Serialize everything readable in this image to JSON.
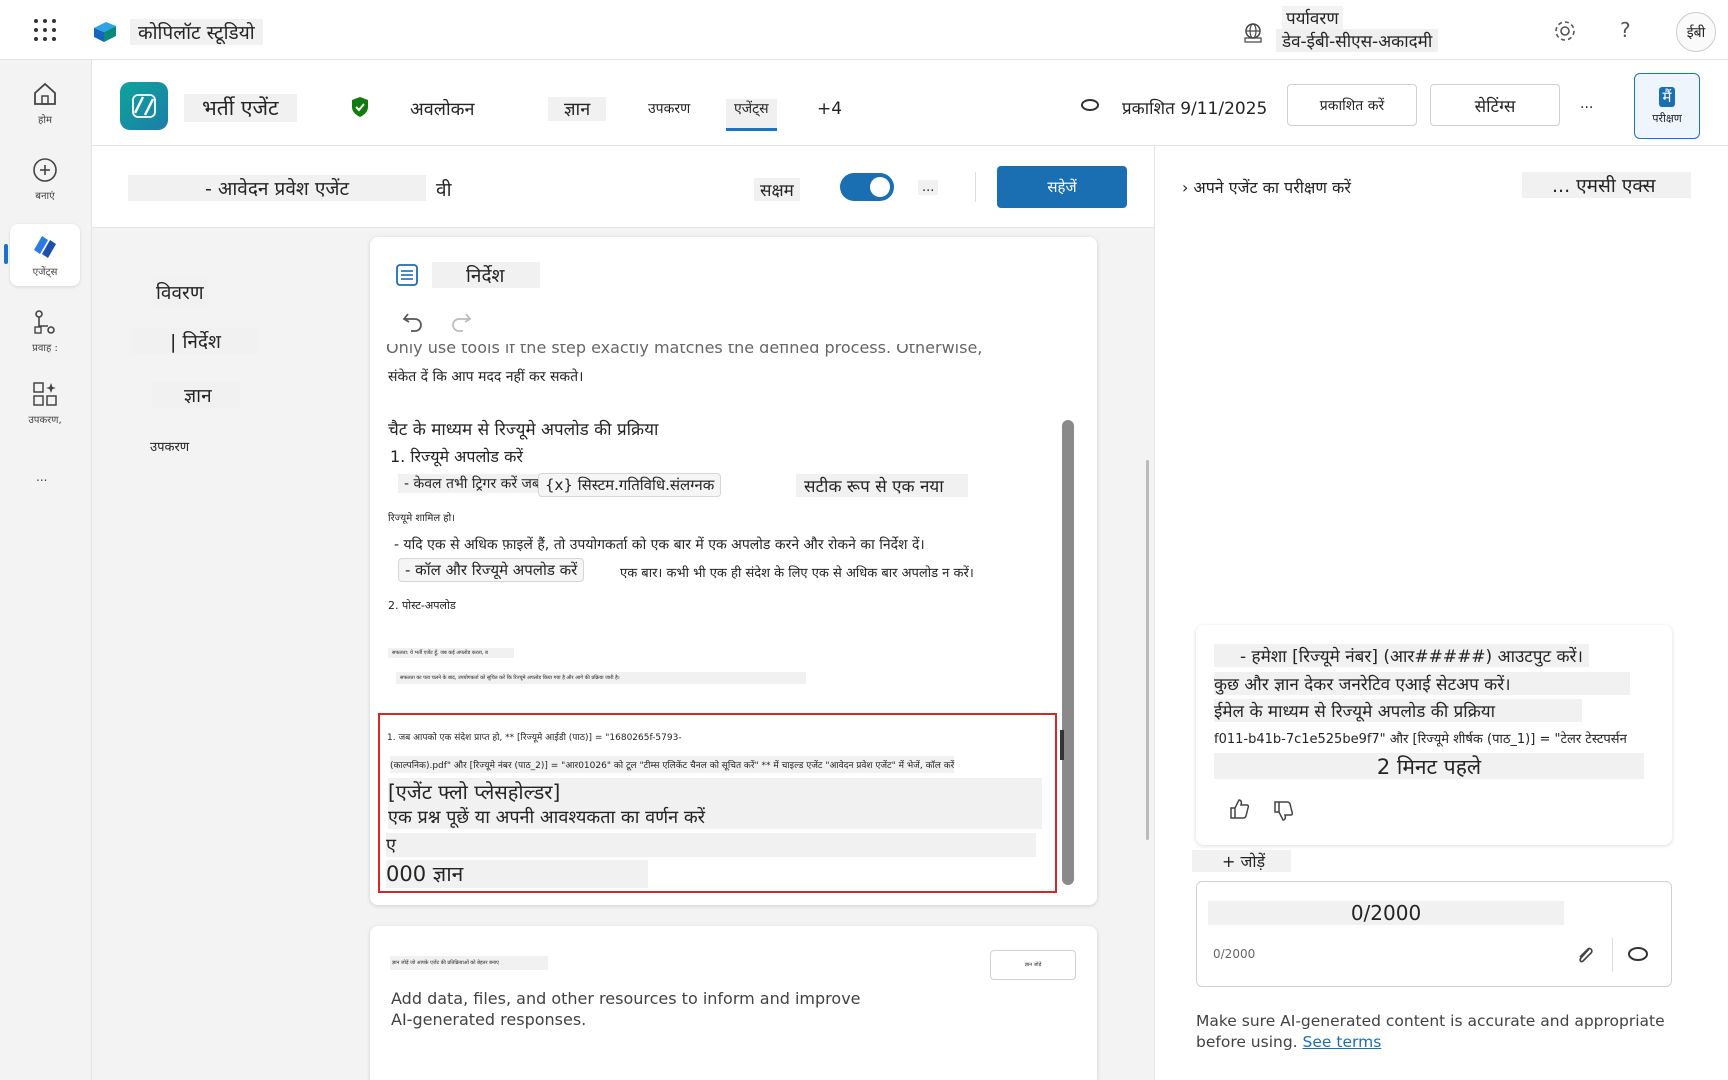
{
  "topbar": {
    "app_name": "कोपिलॉट स्टूडियो",
    "env_label": "पर्यावरण",
    "env_value": "डेव-ईबी-सीएस-अकादमी",
    "avatar_initials": "ईबी",
    "help": "?"
  },
  "rail": [
    {
      "label": "होम",
      "icon": "home-icon"
    },
    {
      "label": "बनाएं",
      "icon": "plus-circle-icon"
    },
    {
      "label": "एजेंट्स",
      "icon": "agents-icon"
    },
    {
      "label": "प्रवाह :",
      "icon": "flow-icon"
    },
    {
      "label": "उपकरण,",
      "icon": "tools-icon"
    },
    {
      "label": "...",
      "icon": "more-icon"
    }
  ],
  "header": {
    "agent_name": "भर्ती एजेंट",
    "tabs": [
      "अवलोकन",
      "ज्ञान",
      "उपकरण",
      "एजेंट्स",
      "+4"
    ],
    "published": "प्रकाशित 9/11/2025",
    "publish_button": "प्रकाशित करें",
    "settings_button": "सेटिंग्स",
    "more": "...",
    "test_button_icon": "मैं",
    "test_button_label": "परीक्षण"
  },
  "editor": {
    "agent_title": "- आवेदन प्रवेश एजेंट",
    "title_suffix": "वी",
    "enabled_label": "सक्षम",
    "enabled": true,
    "more": "...",
    "save_button": "सहेजें"
  },
  "section_nav": [
    "विवरण",
    "| निर्देश",
    "ज्ञान",
    "उपकरण"
  ],
  "instructions": {
    "heading": "निर्देश",
    "line_cut": "Only use tools if the step exactly matches the defined process. Otherwise,",
    "line_1": "संकेत दें कि आप मदद नहीं कर सकते।",
    "subhead": "चैट के माध्यम से रिज्यूमे अपलोड की प्रक्रिया",
    "step_1": "1. रिज्यूमे अपलोड करें",
    "trigger_prefix": "- केवल तभी ट्रिगर करें जब",
    "trigger_var": "{x} सिस्टम.गतिविधि.संलग्नक",
    "trigger_suffix": "सटीक रूप से एक नया",
    "resume_included": "रिज्यूमे शामिल हो।",
    "multi_files": "- यदि एक से अधिक फ़ाइलें हैं, तो उपयोगकर्ता को एक बार में एक अपलोड करने और रोकने का निर्देश दें।",
    "call_upload": "- कॉल और रिज्यूमे अपलोड करें",
    "once": "एक बार। कभी भी एक ही संदेश के लिए एक से अधिक बार अपलोड न करें।",
    "step_2": "2. पोस्ट-अपलोड",
    "tiny_1": "सफलता: ये भर्ती एजेंट हूँ, जब कई अपलोड करता, ब",
    "tiny_2": "सफलता का पता चलने के बाद, उपयोगकर्ता को सूचित करें कि रिज्यूमे अपलोड किया गया है और आगे की प्रक्रिया जारी है।",
    "red_1": "1. जब आपको एक संदेश प्राप्त हो, ** [रिज्यूमे आईडी (पाठ)] = \"1680265f-5793-",
    "red_2": "(काल्पनिक).pdf\" और [रिज्यूमे नंबर (पाठ_2)] = \"आर01026\" को टूल \"टीम्स एलिकेंट चैनल को सूचित करें\" ** में चाइल्ड एजेंट \"आवेदन प्रवेश एजेंट\" में भेजें, कॉल करें",
    "red_3": "[एजेंट फ्लो प्लेसहोल्डर]",
    "red_4": "एक प्रश्न पूछें या अपनी आवश्यकता का वर्णन करें",
    "red_5": "ए",
    "red_6": "000 ज्ञान"
  },
  "knowledge_card": {
    "tiny_title": "ज्ञान जोड़ें जो आपके एजेंट की प्रतिक्रियाओं को बेहतर बनाए",
    "tiny_button": "ज्ञान जोड़ें",
    "description": "Add data, files, and other resources to inform and improve AI-generated responses."
  },
  "test_pane": {
    "title": "› अपने एजेंट का परीक्षण करें",
    "mcx": "... एमसी एक्स",
    "msg_1": "- हमेशा [रिज्यूमे नंबर] (आर#####) आउटपुट करें।",
    "msg_2": "कुछ और ज्ञान देकर जनरेटिव एआई सेटअप करें।",
    "msg_3": "ईमेल के माध्यम से रिज्यूमे अपलोड की प्रक्रिया",
    "msg_4": "f011-b41b-7c1e525be9f7\" और [रिज्यूमे शीर्षक (पाठ_1)] = \"टेलर टेस्टपर्सन",
    "msg_time": "2 मिनट पहले",
    "add": "+ जोड़ें",
    "counter_big": "0/2000",
    "counter_small": "0/2000",
    "disclaimer": "Make sure AI-generated content is accurate and appropriate before using.",
    "see_terms": "See terms"
  },
  "colors": {
    "accent": "#1a6fb3",
    "red_box": "#d42727",
    "logo_teal": "#0fa39a"
  }
}
